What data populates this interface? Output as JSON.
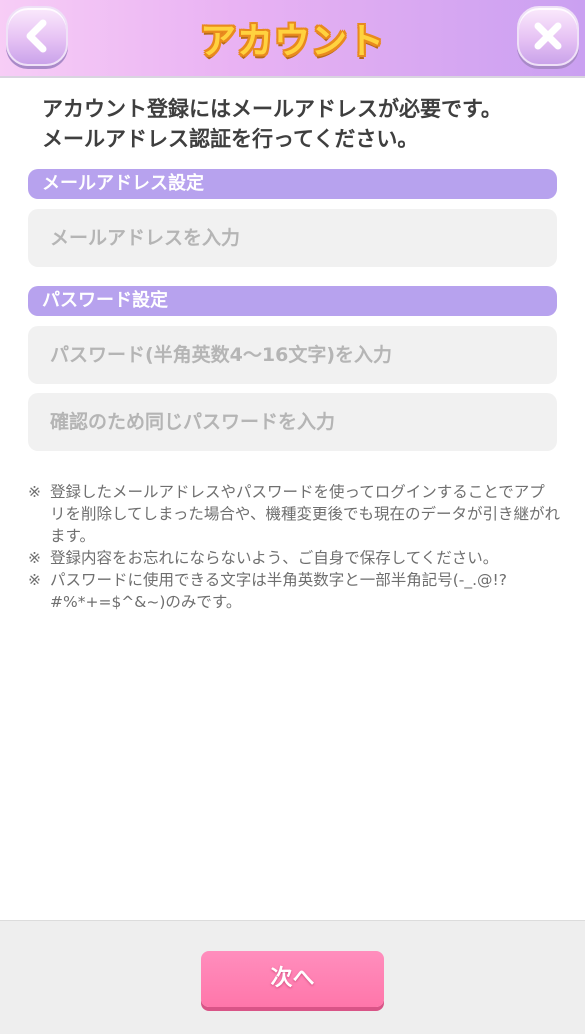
{
  "header": {
    "title": "アカウント",
    "back_icon": "chevron-left-icon",
    "close_icon": "close-icon"
  },
  "intro": {
    "line1": "アカウント登録にはメールアドレスが必要です。",
    "line2": "メールアドレス認証を行ってください。"
  },
  "email_section": {
    "title": "メールアドレス設定",
    "email_placeholder": "メールアドレスを入力",
    "email_value": ""
  },
  "password_section": {
    "title": "パスワード設定",
    "password_placeholder": "パスワード(半角英数4〜16文字)を入力",
    "password_value": "",
    "confirm_placeholder": "確認のため同じパスワードを入力",
    "confirm_value": ""
  },
  "notes": {
    "mark": "※",
    "items": [
      "登録したメールアドレスやパスワードを使ってログインすることでアプリを削除してしまった場合や、機種変更後でも現在のデータが引き継がれます。",
      "登録内容をお忘れにならないよう、ご自身で保存してください。",
      "パスワードに使用できる文字は半角英数字と一部半角記号(-_.@!?#%*+=$^&~)のみです。"
    ]
  },
  "footer": {
    "next_label": "次へ"
  },
  "colors": {
    "section_header": "#b7a2ee",
    "next_button": "#ff7fb0",
    "title_fill": "#ffd23f",
    "title_outline": "#e98a1e"
  }
}
